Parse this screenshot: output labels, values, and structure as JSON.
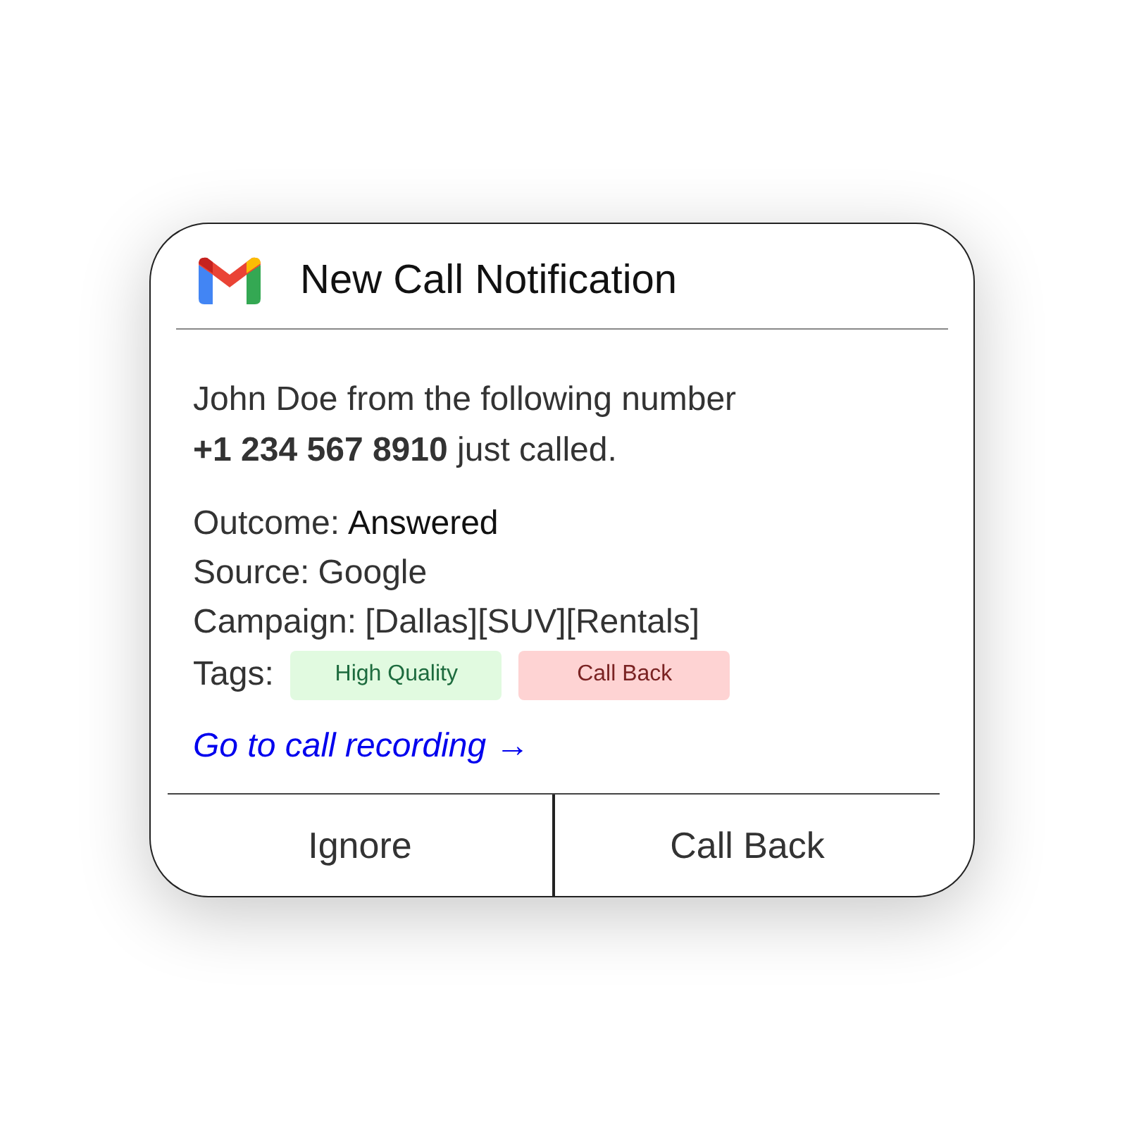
{
  "header": {
    "title": "New Call Notification"
  },
  "message": "John Doe from the following number\n**+1 234 567 8910** just called.",
  "details": [
    {
      "label": "Outcome:",
      "value": "Answered",
      "emphasis": true
    },
    {
      "label": "Source:",
      "value": "Google",
      "emphasis": false
    },
    {
      "label": "Campaign:",
      "value": "[Dallas][SUV][Rentals]",
      "emphasis": false
    }
  ],
  "tags": {
    "label": "Tags:",
    "items": [
      {
        "text": "High Quality",
        "color": "#e1fae0"
      },
      {
        "text": "Call Back",
        "color": "#fed3d3"
      }
    ]
  },
  "link": "Go to call recording →",
  "buttons": [
    "Ignore",
    "Call Back"
  ]
}
